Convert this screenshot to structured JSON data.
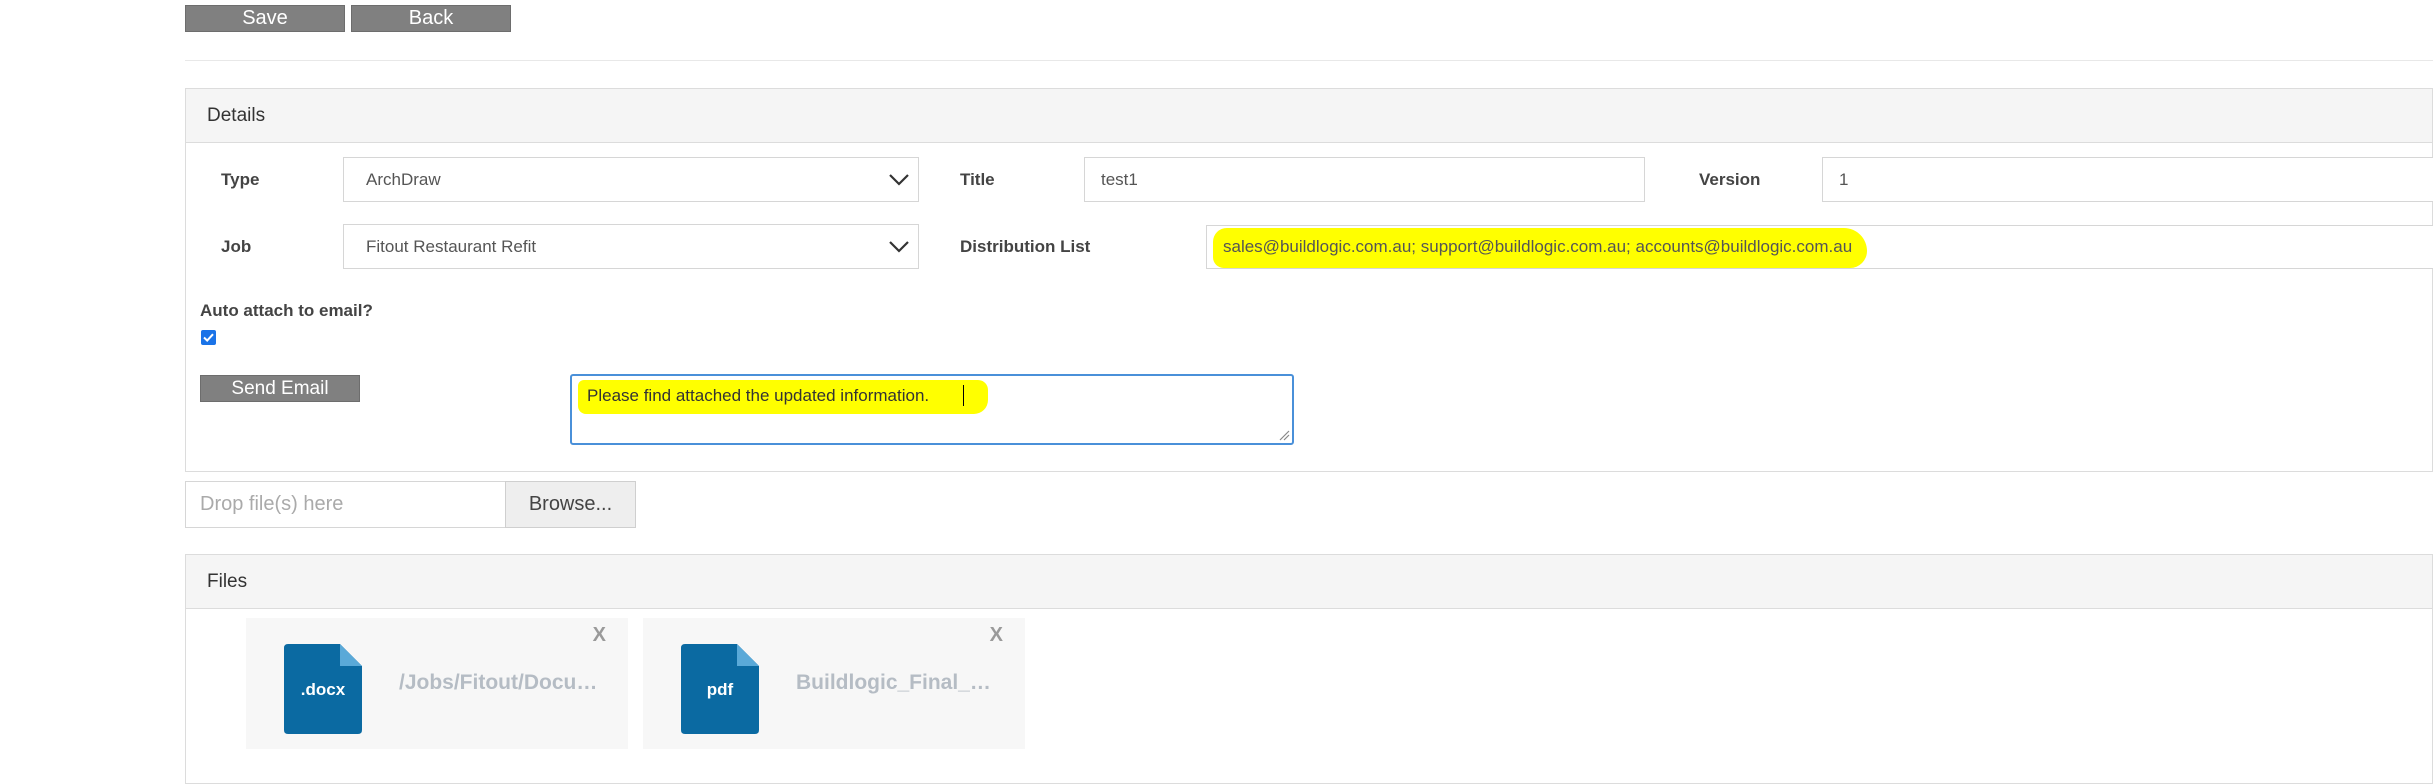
{
  "toolbar": {
    "save_label": "Save",
    "back_label": "Back"
  },
  "details": {
    "heading": "Details",
    "type_label": "Type",
    "type_value": "ArchDraw",
    "title_label": "Title",
    "title_value": "test1",
    "version_label": "Version",
    "version_value": "1",
    "job_label": "Job",
    "job_value": "Fitout Restaurant Refit",
    "distribution_label": "Distribution List",
    "distribution_value": "sales@buildlogic.com.au; support@buildlogic.com.au; accounts@buildlogic.com.au",
    "auto_attach_label": "Auto attach to email?",
    "auto_attach_checked": true,
    "send_email_label": "Send Email",
    "message_value": "Please find attached the updated information."
  },
  "upload": {
    "drop_placeholder": "Drop file(s) here",
    "browse_label": "Browse..."
  },
  "files": {
    "heading": "Files",
    "items": [
      {
        "icon_label": ".docx",
        "name": "/Jobs/Fitout/Docu…",
        "close": "X"
      },
      {
        "icon_label": "pdf",
        "name": "Buildlogic_Final_…",
        "close": "X"
      }
    ]
  },
  "colors": {
    "file_icon": "#0b6aa2",
    "highlight": "#ffff00",
    "button": "#808080",
    "focus_border": "#4a90d9"
  },
  "icons": [
    "chevron-down-icon",
    "checkbox-icon",
    "docx-file-icon",
    "pdf-file-icon",
    "close-icon",
    "resize-handle-icon"
  ]
}
